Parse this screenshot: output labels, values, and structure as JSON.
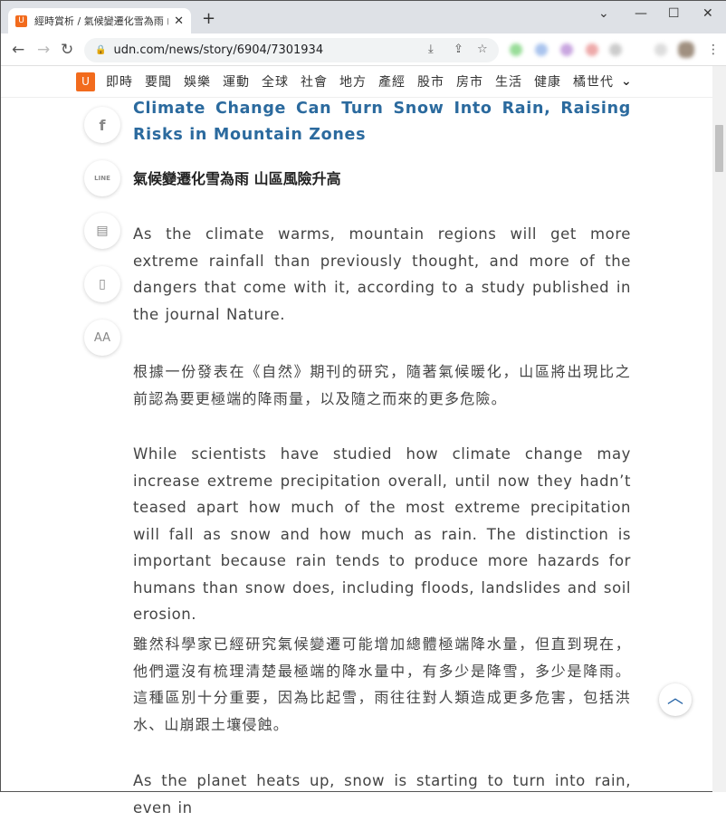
{
  "browser": {
    "tab_title": "經時賞析 / 氣候變遷化雪為雨 山區",
    "url": "udn.com/news/story/6904/7301934"
  },
  "site_nav": {
    "logo": "U",
    "items": [
      "即時",
      "要聞",
      "娛樂",
      "運動",
      "全球",
      "社會",
      "地方",
      "產經",
      "股市",
      "房市",
      "生活",
      "健康",
      "橘世代"
    ]
  },
  "side_tools": [
    "facebook-icon",
    "line-icon",
    "comment-icon",
    "bookmark-icon",
    "font-size-icon"
  ],
  "side_labels": {
    "line": "LINE",
    "font": "AA"
  },
  "article": {
    "title": "Climate Change Can Turn Snow Into Rain, Raising Risks in Mountain Zones",
    "subtitle": "氣候變遷化雪為雨 山區風險升高",
    "paragraphs": [
      "As the climate warms, mountain regions will get more extreme rainfall than previously thought, and more of the dangers that come with it, according to a study published in the journal Nature.",
      "根據一份發表在《自然》期刊的研究，隨著氣候暖化，山區將出現比之前認為要更極端的降雨量，以及隨之而來的更多危險。",
      "While scientists have studied how climate change may increase extreme precipitation overall, until now they hadn’t teased apart how much of the most extreme precipitation will fall as snow and how much as rain. The distinction is important because rain tends to produce more hazards for humans than snow does, including floods, landslides and soil erosion.",
      "雖然科學家已經研究氣候變遷可能增加總體極端降水量，但直到現在，他們還沒有梳理清楚最極端的降水量中，有多少是降雪，多少是降雨。這種區別十分重要，因為比起雪，雨往往對人類造成更多危害，包括洪水、山崩跟土壤侵蝕。",
      "As the planet heats up, snow is starting to turn into rain, even in"
    ]
  }
}
